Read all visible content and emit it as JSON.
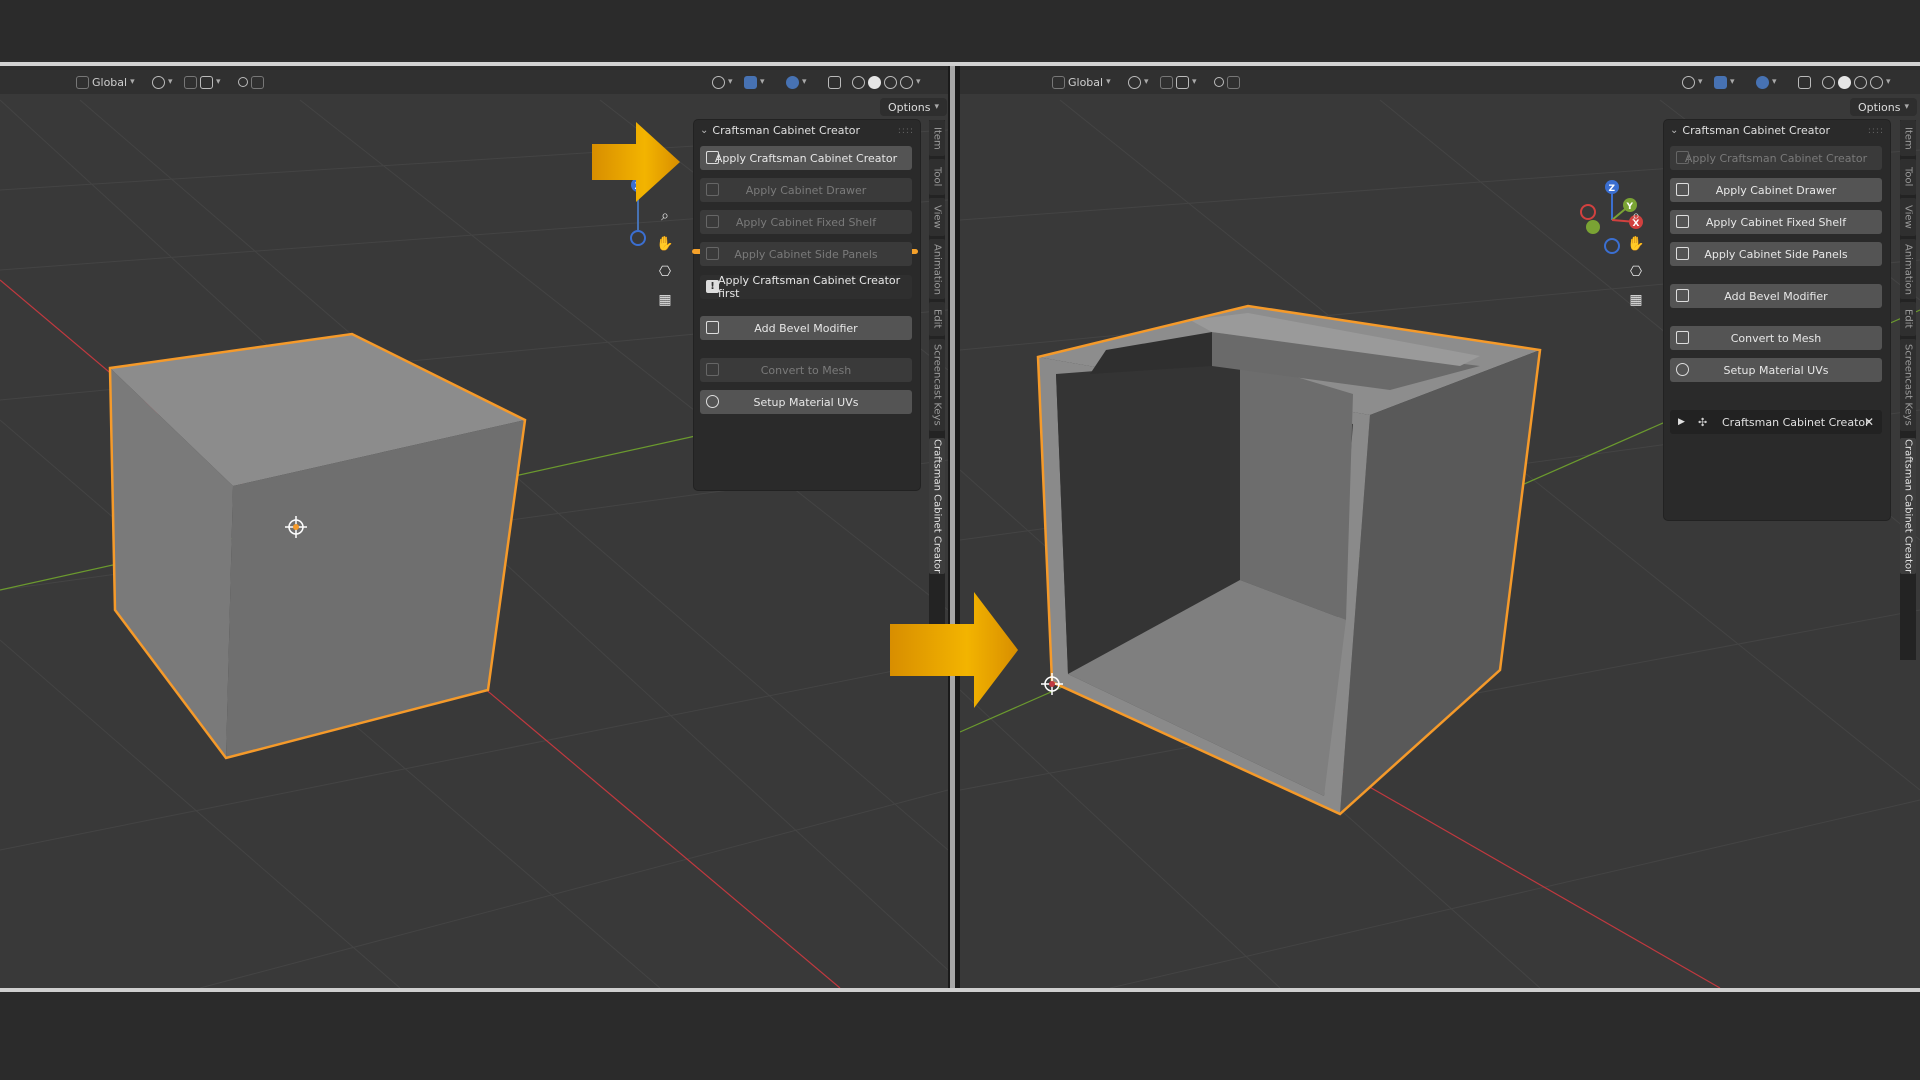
{
  "header": {
    "orientation_label": "Global",
    "options_label": "Options"
  },
  "addon_panel": {
    "title": "Craftsman Cabinet Creator",
    "left_buttons": [
      {
        "label": "Apply Craftsman Cabinet Creator",
        "enabled": true,
        "icon": "cabinet-icon"
      },
      {
        "label": "Apply Cabinet Drawer",
        "enabled": false,
        "icon": "drawer-icon"
      },
      {
        "label": "Apply Cabinet Fixed Shelf",
        "enabled": false,
        "icon": "shelf-icon"
      },
      {
        "label": "Apply Cabinet Side Panels",
        "enabled": false,
        "icon": "side-panel-icon"
      },
      {
        "label": "Apply Craftsman Cabinet Creator first",
        "enabled": true,
        "icon": "info-icon"
      },
      {
        "label": "Add Bevel Modifier",
        "enabled": true,
        "icon": "bevel-icon"
      },
      {
        "label": "Convert to Mesh",
        "enabled": false,
        "icon": "mesh-icon"
      },
      {
        "label": "Setup Material UVs",
        "enabled": true,
        "icon": "uv-icon"
      }
    ],
    "right_buttons": [
      {
        "label": "Apply Craftsman Cabinet Creator",
        "enabled": false,
        "icon": "cabinet-icon"
      },
      {
        "label": "Apply Cabinet Drawer",
        "enabled": true,
        "icon": "drawer-icon"
      },
      {
        "label": "Apply Cabinet Fixed Shelf",
        "enabled": true,
        "icon": "shelf-icon"
      },
      {
        "label": "Apply Cabinet Side Panels",
        "enabled": true,
        "icon": "side-panel-icon"
      },
      {
        "label": "Add Bevel Modifier",
        "enabled": true,
        "icon": "bevel-icon"
      },
      {
        "label": "Convert to Mesh",
        "enabled": true,
        "icon": "mesh-icon"
      },
      {
        "label": "Setup Material UVs",
        "enabled": true,
        "icon": "uv-icon"
      }
    ],
    "operator_subpanel": "Craftsman Cabinet Creator"
  },
  "sidebar_tabs": [
    "Item",
    "Tool",
    "View",
    "Animation",
    "Edit",
    "Screencast Keys",
    "Craftsman Cabinet Creator"
  ],
  "gizmo": {
    "z": "Z",
    "y": "Y",
    "x": "X"
  },
  "colors": {
    "accent_orange": "#f5a12a",
    "arrow_orange": "#e8a010",
    "selection_outline": "#f59a2a",
    "axis_red": "#c0393f",
    "axis_green": "#6b9a2e",
    "active_blue": "#4772b3"
  }
}
